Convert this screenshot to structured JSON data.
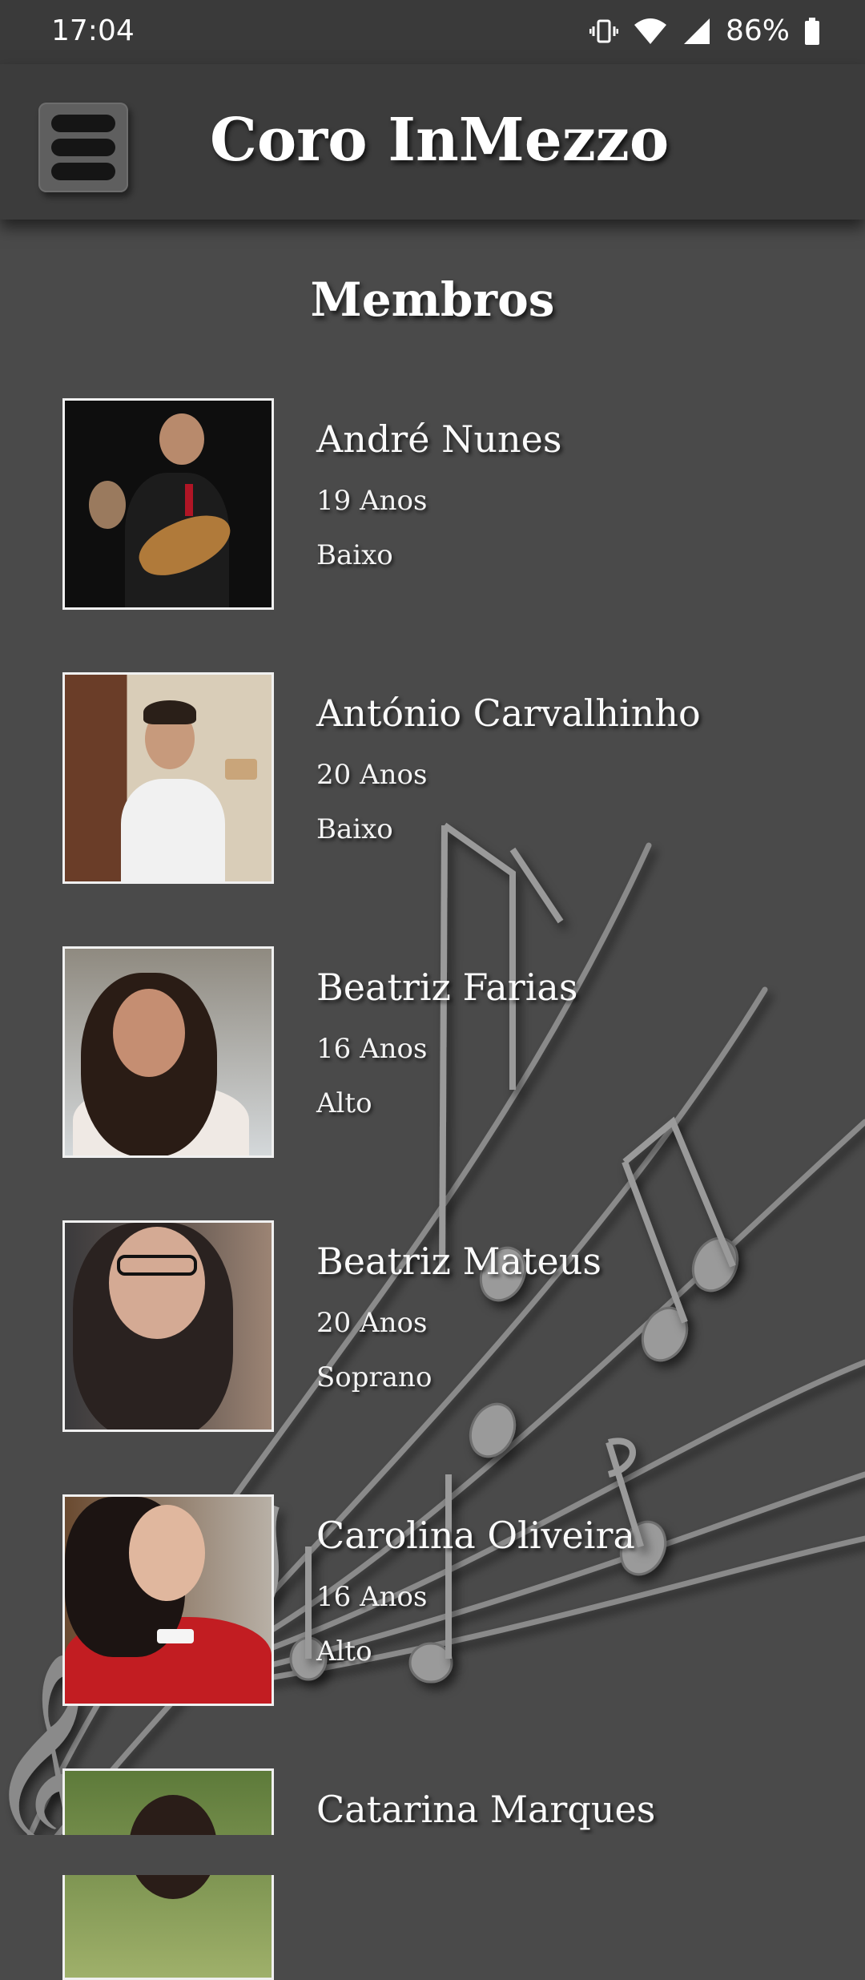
{
  "status_bar": {
    "time": "17:04",
    "battery": "86%"
  },
  "app_bar": {
    "title": "Coro InMezzo"
  },
  "page": {
    "title": "Membros"
  },
  "members": [
    {
      "name": "André Nunes",
      "age": "19 Anos",
      "voice": "Baixo"
    },
    {
      "name": "António Carvalhinho",
      "age": "20 Anos",
      "voice": "Baixo"
    },
    {
      "name": "Beatriz Farias",
      "age": "16 Anos",
      "voice": "Alto"
    },
    {
      "name": "Beatriz Mateus",
      "age": "20 Anos",
      "voice": "Soprano"
    },
    {
      "name": "Carolina Oliveira",
      "age": "16 Anos",
      "voice": "Alto"
    },
    {
      "name": "Catarina Marques"
    }
  ]
}
